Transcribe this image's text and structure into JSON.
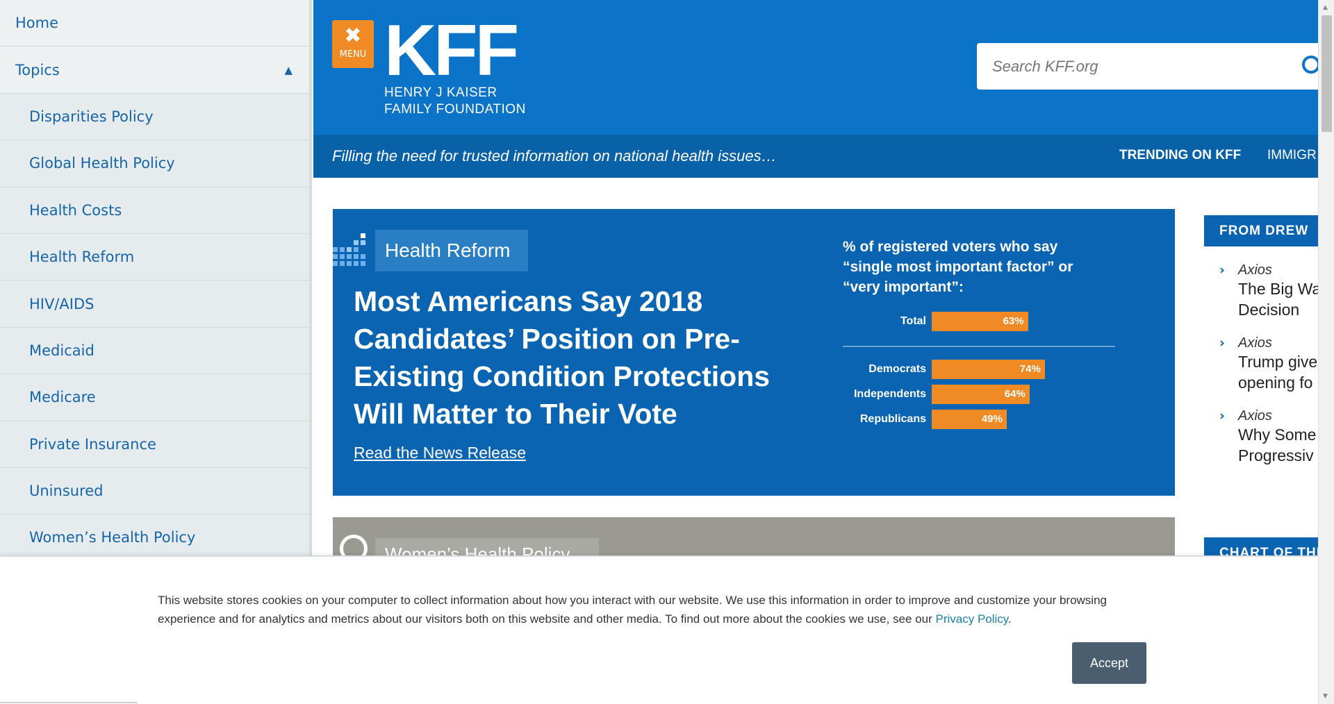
{
  "sidebar": {
    "home_label": "Home",
    "topics_label": "Topics",
    "items": [
      {
        "label": "Disparities Policy"
      },
      {
        "label": "Global Health Policy"
      },
      {
        "label": "Health Costs"
      },
      {
        "label": "Health Reform"
      },
      {
        "label": "HIV/AIDS"
      },
      {
        "label": "Medicaid"
      },
      {
        "label": "Medicare"
      },
      {
        "label": "Private Insurance"
      },
      {
        "label": "Uninsured"
      },
      {
        "label": "Women’s Health Policy"
      }
    ]
  },
  "header": {
    "menu_label": "MENU",
    "logo_text": "KFF",
    "logo_sub1": "HENRY J KAISER",
    "logo_sub2": "FAMILY FOUNDATION",
    "search_placeholder": "Search KFF.org",
    "tagline": "Filling the need for trusted information on national health issues…",
    "trending_label": "TRENDING ON KFF",
    "trending_item": "IMMIGR"
  },
  "feature": {
    "topic": "Health Reform",
    "headline": "Most Americans Say 2018 Candidates’ Position on Pre-Existing Condition Protections Will Matter to Their Vote",
    "link": "Read the News Release"
  },
  "chart_data": {
    "type": "bar",
    "title": "% of registered voters who say “single most important factor” or “very important”:",
    "categories": [
      "Total",
      "Democrats",
      "Independents",
      "Republicans"
    ],
    "values": [
      63,
      74,
      64,
      49
    ],
    "value_labels": [
      "63%",
      "74%",
      "64%",
      "49%"
    ],
    "xlim": [
      0,
      100
    ],
    "bar_color": "#f08a24"
  },
  "feature2": {
    "topic": "Women’s Health Policy"
  },
  "right": {
    "heading": "FROM DREW",
    "items": [
      {
        "source": "Axios",
        "title1": "The Big Wa",
        "title2": "Decision"
      },
      {
        "source": "Axios",
        "title1": "Trump give",
        "title2": "opening fo"
      },
      {
        "source": "Axios",
        "title1": "Why Some",
        "title2": "Progressiv"
      }
    ],
    "heading2": "CHART OF THE"
  },
  "cookie": {
    "text_before": "This website stores cookies on your computer to collect information about how you interact with our website. We use this information in order to improve and customize your browsing experience and for analytics and metrics about our visitors both on this website and other media. To find out more about the cookies we use, see our ",
    "link": "Privacy Policy",
    "text_after": ".",
    "accept_label": "Accept"
  },
  "colors": {
    "brand_blue": "#0b74c9",
    "accent_orange": "#f08a24",
    "link_blue": "#1565a8"
  }
}
